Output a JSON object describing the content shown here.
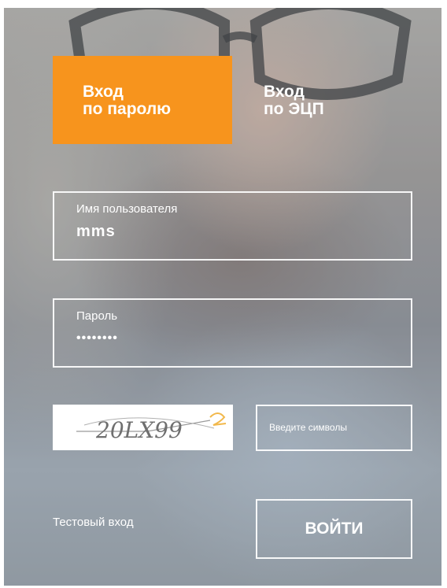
{
  "tabs": {
    "password": {
      "line1": "Вход",
      "line2": "по паролю"
    },
    "eds": {
      "line1": "Вход",
      "line2": "по ЭЦП"
    }
  },
  "form": {
    "username": {
      "label": "Имя пользователя",
      "value": "mms"
    },
    "password": {
      "label": "Пароль",
      "value": "••••••••"
    },
    "captcha": {
      "image_text": "20LX99",
      "placeholder": "Введите символы"
    },
    "test_login": "Тестовый вход",
    "submit_label": "ВОЙТИ"
  },
  "colors": {
    "accent": "#f7941d",
    "text": "#ffffff"
  }
}
